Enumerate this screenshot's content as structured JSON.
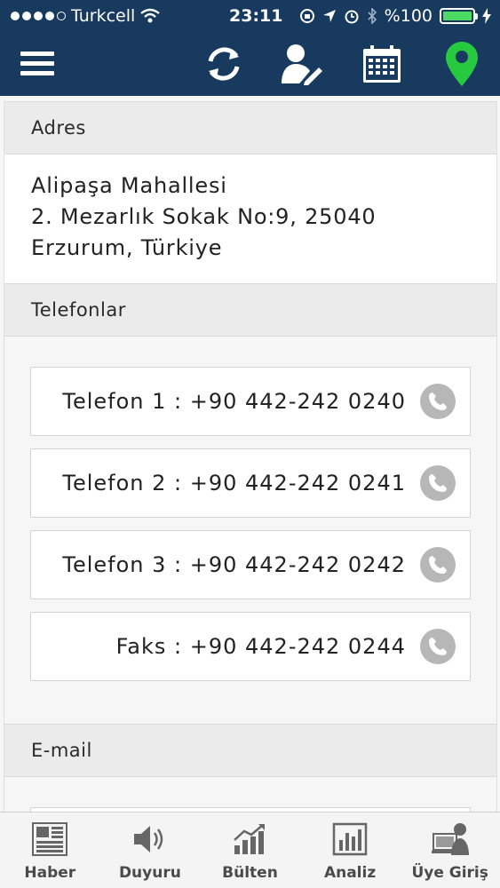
{
  "status_bar": {
    "carrier": "Turkcell",
    "time": "23:11",
    "battery": "%100"
  },
  "colors": {
    "header_bg": "#173a5e",
    "location_icon": "#27c93f",
    "battery_fill": "#4cd964",
    "phone_icon_bg": "#b7b7b7"
  },
  "toolbar": {
    "icons": [
      "menu-icon",
      "refresh-icon",
      "edit-profile-icon",
      "calendar-icon",
      "location-pin-icon"
    ]
  },
  "address": {
    "heading": "Adres",
    "line1": "Alipaşa Mahallesi",
    "line2": "2. Mezarlık Sokak No:9, 25040",
    "line3": "Erzurum, Türkiye"
  },
  "phones": {
    "heading": "Telefonlar",
    "items": [
      {
        "label": "Telefon 1 : +90 442-242 0240"
      },
      {
        "label": "Telefon 2 : +90 442-242 0241"
      },
      {
        "label": "Telefon 3 : +90 442-242 0242"
      },
      {
        "label": "Faks : +90 442-242 0244"
      }
    ]
  },
  "email": {
    "heading": "E-mail"
  },
  "tabs": [
    {
      "label": "Haber",
      "icon": "newspaper-icon"
    },
    {
      "label": "Duyuru",
      "icon": "speaker-icon"
    },
    {
      "label": "Bülten",
      "icon": "growth-chart-icon"
    },
    {
      "label": "Analiz",
      "icon": "bar-chart-icon"
    },
    {
      "label": "Üye Giriş",
      "icon": "member-login-icon"
    }
  ]
}
